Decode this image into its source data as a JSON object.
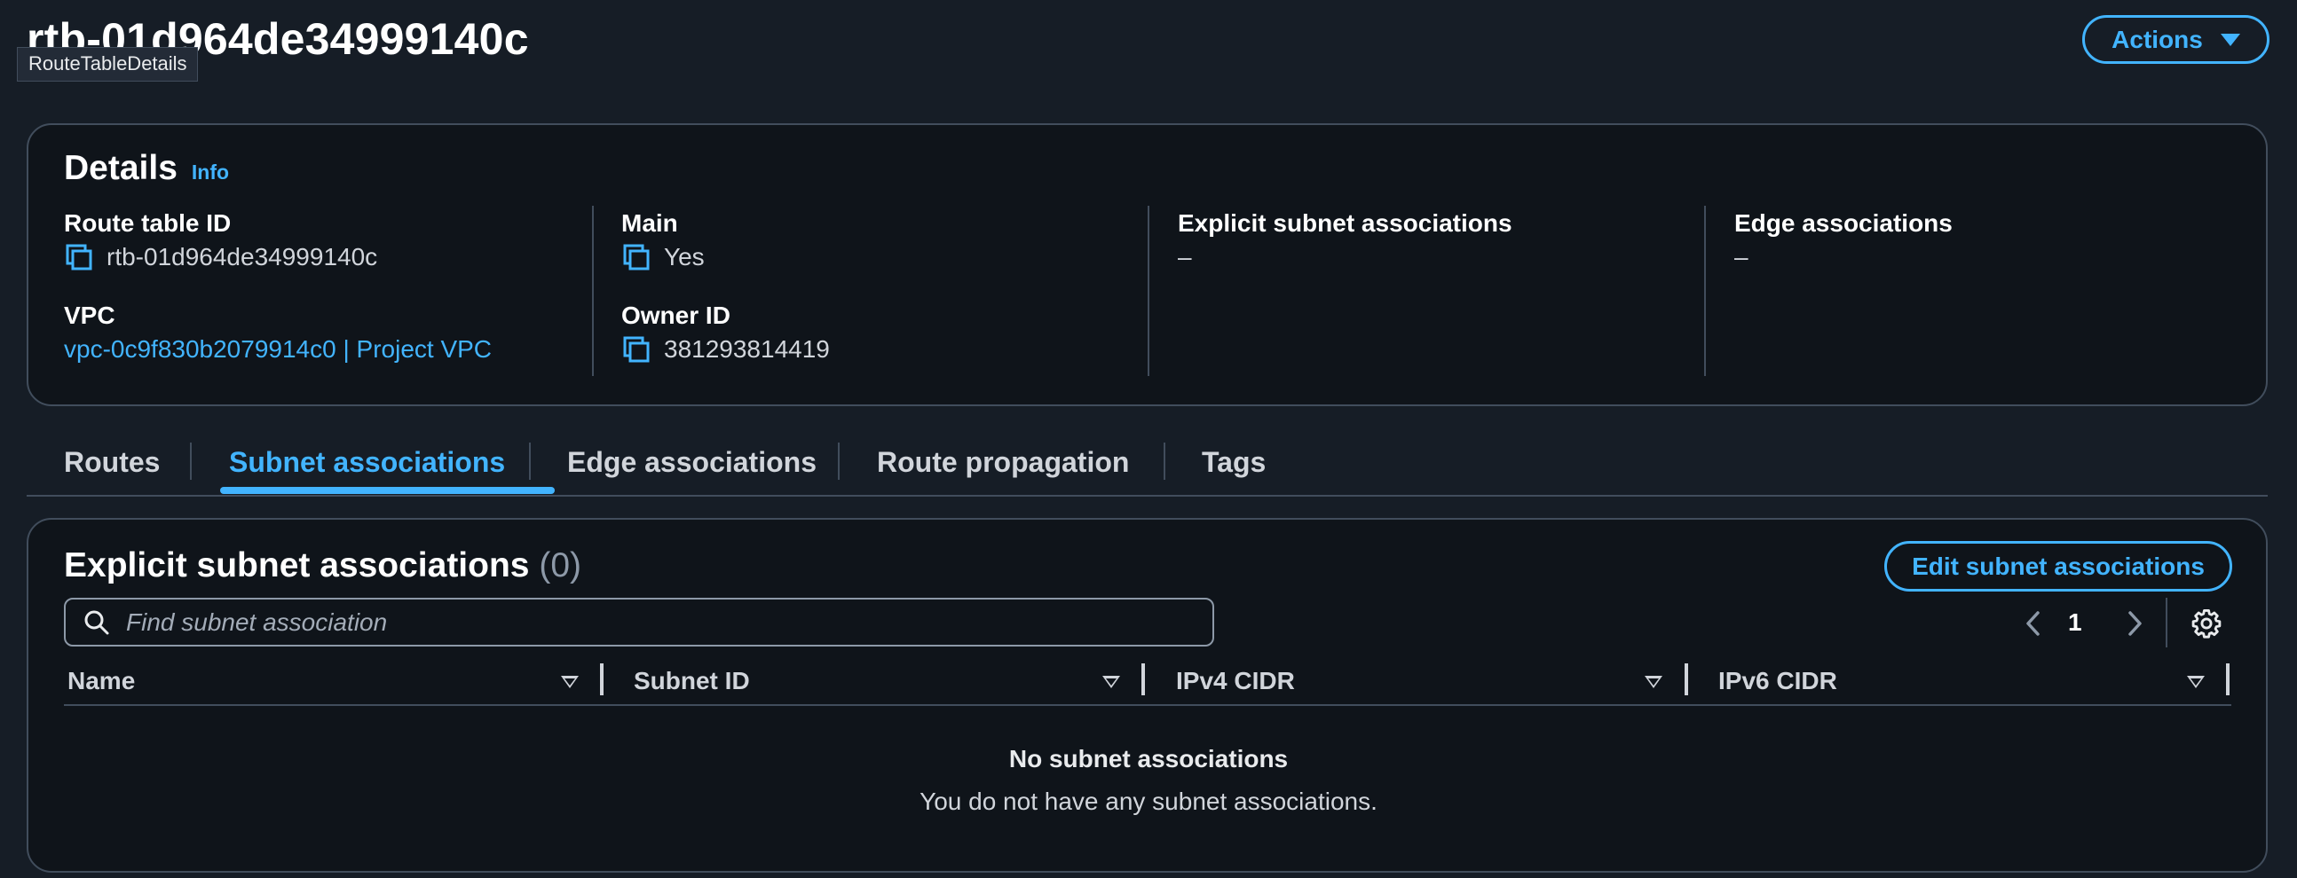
{
  "page": {
    "title": "rtb-01d964de34999140c",
    "tooltip": "RouteTableDetails",
    "actions_label": "Actions"
  },
  "details": {
    "title": "Details",
    "info_label": "Info",
    "route_table_id": {
      "label": "Route table ID",
      "value": "rtb-01d964de34999140c"
    },
    "vpc": {
      "label": "VPC",
      "value": "vpc-0c9f830b2079914c0 | Project VPC"
    },
    "main": {
      "label": "Main",
      "value": "Yes"
    },
    "owner_id": {
      "label": "Owner ID",
      "value": "381293814419"
    },
    "explicit_subnet_associations": {
      "label": "Explicit subnet associations",
      "value": "–"
    },
    "edge_associations": {
      "label": "Edge associations",
      "value": "–"
    }
  },
  "tabs": [
    {
      "label": "Routes",
      "active": false
    },
    {
      "label": "Subnet associations",
      "active": true
    },
    {
      "label": "Edge associations",
      "active": false
    },
    {
      "label": "Route propagation",
      "active": false
    },
    {
      "label": "Tags",
      "active": false
    }
  ],
  "subnet_panel": {
    "title": "Explicit subnet associations",
    "count": "(0)",
    "edit_label": "Edit subnet associations",
    "search_placeholder": "Find subnet association",
    "page_number": "1",
    "columns": [
      "Name",
      "Subnet ID",
      "IPv4 CIDR",
      "IPv6 CIDR"
    ],
    "empty_title": "No subnet associations",
    "empty_text": "You do not have any subnet associations."
  },
  "colors": {
    "accent": "#42b4ff",
    "background": "#161d26",
    "border": "#414d5c"
  }
}
